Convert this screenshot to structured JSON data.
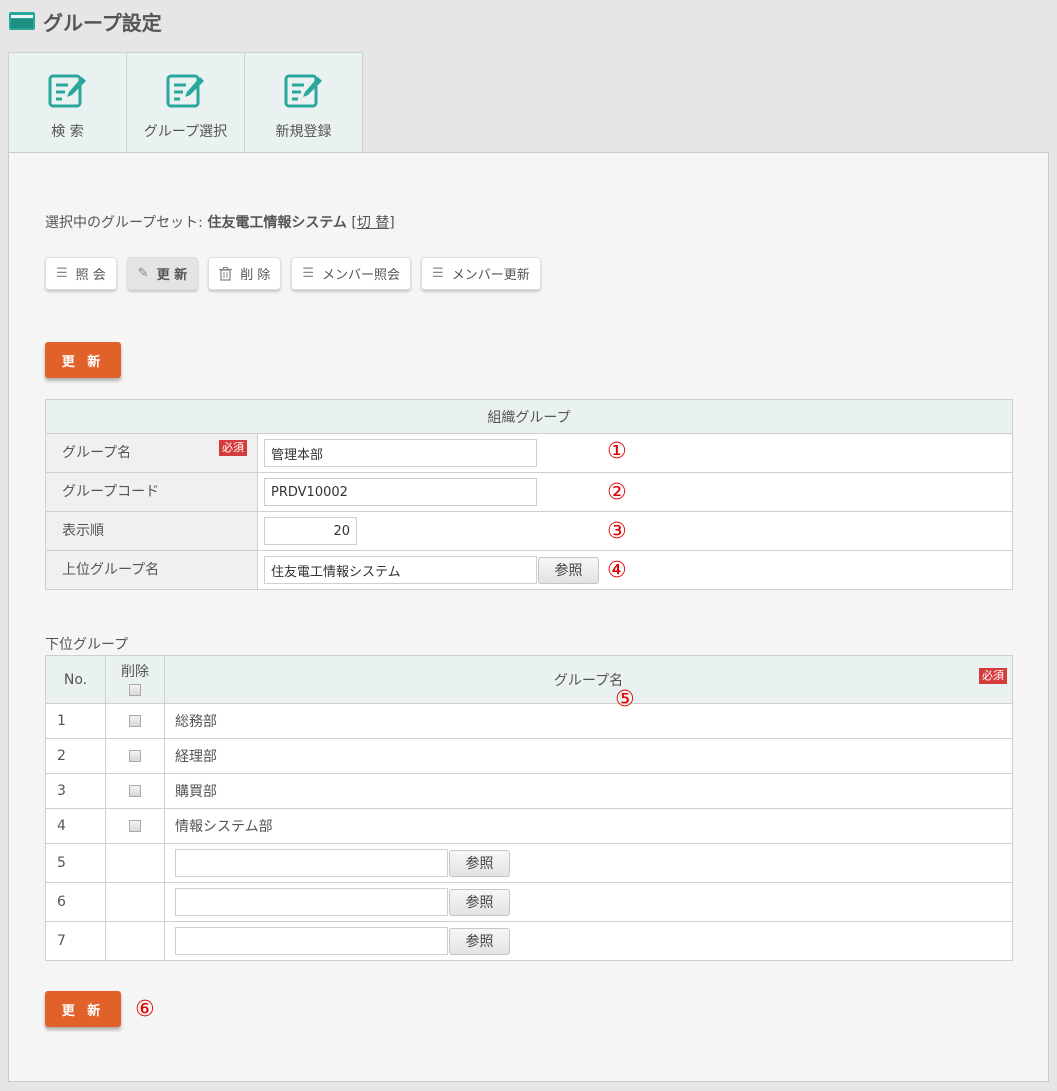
{
  "page": {
    "title": "グループ設定"
  },
  "tabs": [
    {
      "label": "検 索",
      "icon": "edit-document-icon"
    },
    {
      "label": "グループ選択",
      "icon": "edit-document-icon"
    },
    {
      "label": "新規登録",
      "icon": "edit-document-icon"
    }
  ],
  "groupset": {
    "prefix": "選択中のグループセット: ",
    "name": "住友電工情報システム",
    "switch_open": " [",
    "switch_label": "切 替",
    "switch_close": "]"
  },
  "toolbar": [
    {
      "label": "照 会",
      "icon": "list-icon",
      "active": false
    },
    {
      "label": "更 新",
      "icon": "pencil-icon",
      "active": true
    },
    {
      "label": "削 除",
      "icon": "trash-icon",
      "active": false
    },
    {
      "label": "メンバー照会",
      "icon": "list-icon",
      "active": false
    },
    {
      "label": "メンバー更新",
      "icon": "list-icon",
      "active": false
    }
  ],
  "update_button": "更 新",
  "org_table": {
    "header": "組織グループ",
    "required_badge": "必須",
    "rows": [
      {
        "label": "グループ名",
        "value": "管理本部",
        "required": true,
        "callout": "①"
      },
      {
        "label": "グループコード",
        "value": "PRDV10002",
        "required": false,
        "callout": "②"
      },
      {
        "label": "表示順",
        "value": "20",
        "required": false,
        "callout": "③"
      },
      {
        "label": "上位グループ名",
        "value": "住友電工情報システム",
        "required": false,
        "callout": "④",
        "ref_button": "参照"
      }
    ]
  },
  "sub_groups": {
    "label": "下位グループ",
    "col_no": "No.",
    "col_delete": "削除",
    "col_name": "グループ名",
    "required_badge": "必須",
    "name_callout": "⑤",
    "ref_button": "参照",
    "rows": [
      {
        "no": "1",
        "name": "総務部"
      },
      {
        "no": "2",
        "name": "経理部"
      },
      {
        "no": "3",
        "name": "購買部"
      },
      {
        "no": "4",
        "name": "情報システム部"
      },
      {
        "no": "5",
        "name": ""
      },
      {
        "no": "6",
        "name": ""
      },
      {
        "no": "7",
        "name": ""
      }
    ]
  },
  "bottom_callout": "⑥",
  "colors": {
    "accent": "#2aa79b",
    "orange": "#e0622a",
    "required": "#d43c3c",
    "callout": "#e00000"
  }
}
